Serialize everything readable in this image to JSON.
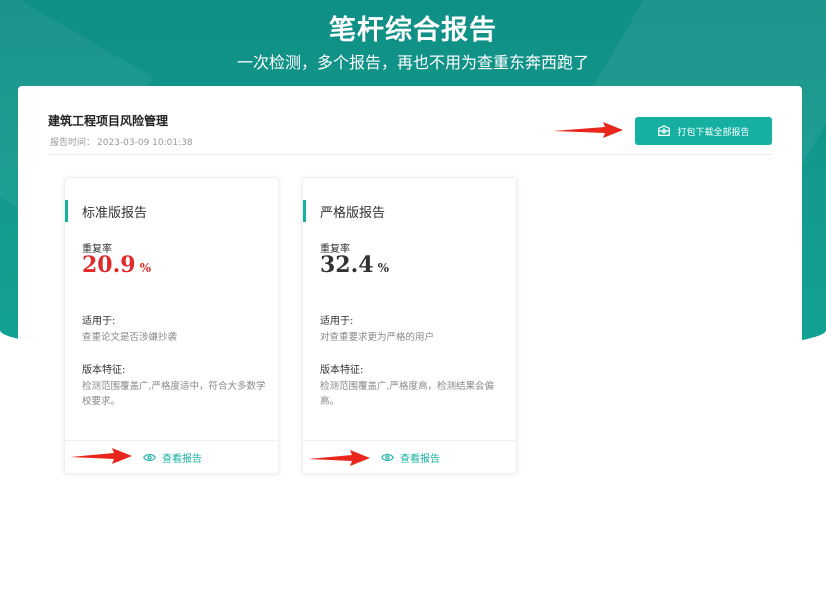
{
  "hero": {
    "title": "笔杆综合报告",
    "subtitle": "一次检测，多个报告，再也不用为查重东奔西跑了"
  },
  "project": {
    "name": "建筑工程项目风险管理",
    "time_label": "报告时间：",
    "time_value": "2023-03-09 10:01:38"
  },
  "download_button": {
    "label": "打包下载全部报告",
    "icon": "package-download-icon"
  },
  "cards": [
    {
      "title": "标准版报告",
      "rate_label": "重复率",
      "rate_value": "20.9",
      "rate_unit": "%",
      "rate_color": "#e02a2a",
      "applicable_label": "适用于:",
      "applicable_text": "查重论文是否涉嫌抄袭",
      "features_label": "版本特征:",
      "features_text": "检测范围覆盖广,严格度适中，符合大多数学校要求。",
      "view_label": "查看报告",
      "view_icon": "eye-icon"
    },
    {
      "title": "严格版报告",
      "rate_label": "重复率",
      "rate_value": "32.4",
      "rate_unit": "%",
      "rate_color": "#333333",
      "applicable_label": "适用于:",
      "applicable_text": "对查重要求更为严格的用户",
      "features_label": "版本特征:",
      "features_text": "检测范围覆盖广,严格度高，检测结果会偏高。",
      "view_label": "查看报告",
      "view_icon": "eye-icon"
    }
  ],
  "colors": {
    "accent": "#16b0a3",
    "hero": "#12998d",
    "arrow": "#e8261c"
  }
}
